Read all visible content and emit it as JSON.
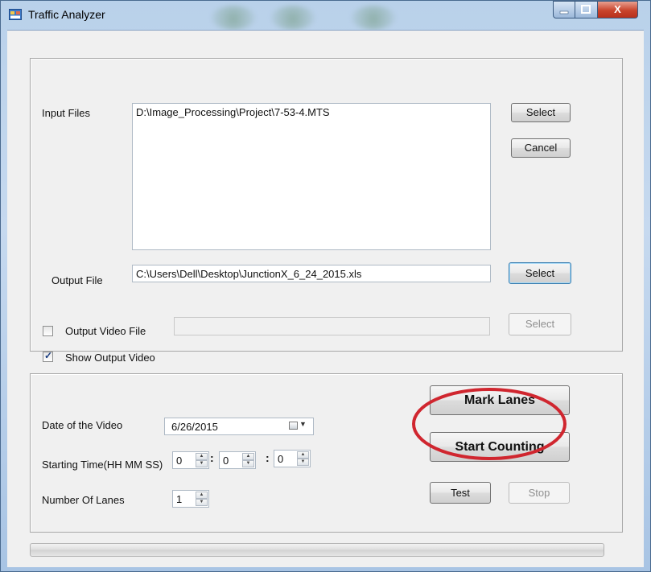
{
  "window": {
    "title": "Traffic Analyzer",
    "close_glyph": "X"
  },
  "input_section": {
    "input_files_label": "Input Files",
    "input_files_value": "D:\\Image_Processing\\Project\\7-53-4.MTS",
    "select_label": "Select",
    "cancel_label": "Cancel",
    "output_file_label": "Output  File",
    "output_file_value": "C:\\Users\\Dell\\Desktop\\JunctionX_6_24_2015.xls",
    "output_select_label": "Select",
    "output_video_label": "Output Video File",
    "output_video_checked": false,
    "output_video_value": "",
    "output_video_select_label": "Select",
    "show_output_video_label": "Show Output Video",
    "show_output_video_checked": true
  },
  "counting_section": {
    "date_label": "Date of the Video",
    "date_value": "6/26/2015",
    "start_time_label": "Starting Time(HH MM SS)",
    "hh": "0",
    "mm": "0",
    "ss": "0",
    "colon": ":",
    "lanes_label": "Number Of Lanes",
    "lanes_value": "1",
    "mark_lanes_label": "Mark Lanes",
    "start_counting_label": "Start Counting",
    "test_label": "Test",
    "stop_label": "Stop"
  },
  "progress": {
    "value": 0
  },
  "colors": {
    "titlebar": "#b9d1ea",
    "client": "#f0f0f0",
    "annotation_circle": "#d0262f",
    "close_button": "#c9442c"
  },
  "icons": {
    "app": "app-window-icon",
    "check": "check-icon",
    "spin_up": "spin-up-icon",
    "spin_down": "spin-down-icon",
    "calendar": "calendar-icon",
    "dropdown": "chevron-down-icon"
  }
}
